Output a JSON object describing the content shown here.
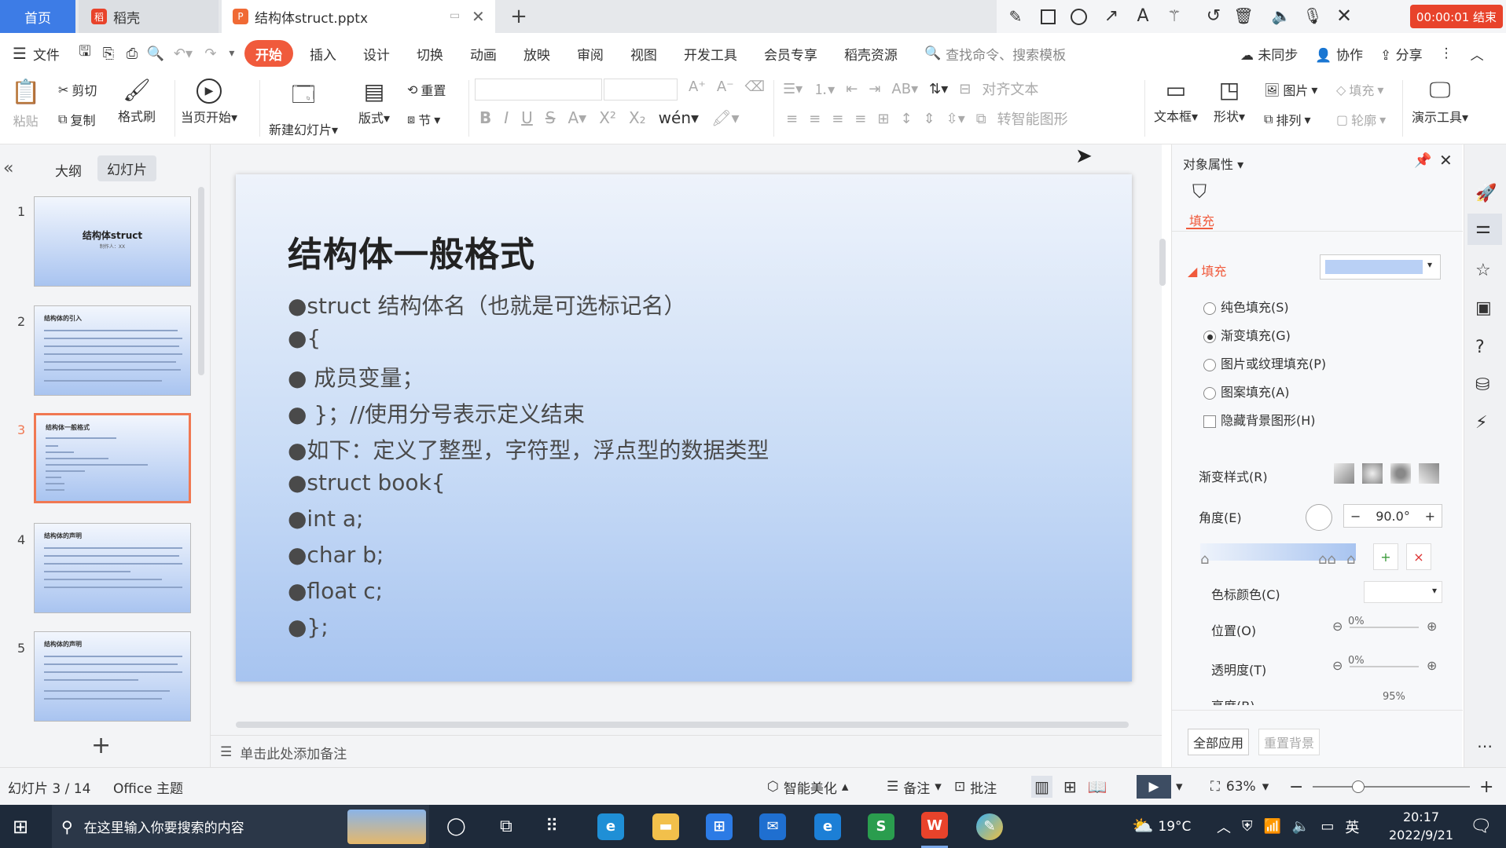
{
  "tabs": {
    "home": "首页",
    "daoke": "稻壳",
    "file": "结构体struct.pptx",
    "add": "+"
  },
  "recording": {
    "timer": "00:00:01 结束"
  },
  "menu": {
    "file": "文件",
    "items": [
      "开始",
      "插入",
      "设计",
      "切换",
      "动画",
      "放映",
      "审阅",
      "视图",
      "开发工具",
      "会员专享",
      "稻壳资源"
    ],
    "search_placeholder": "查找命令、搜索模板",
    "sync": "未同步",
    "collab": "协作",
    "share": "分享"
  },
  "toolbar": {
    "paste": "粘贴",
    "cut": "剪切",
    "copy": "复制",
    "format_painter": "格式刷",
    "from_current": "当页开始",
    "new_slide": "新建幻灯片",
    "layout": "版式",
    "reset": "重置",
    "section": "节",
    "align_text": "对齐文本",
    "convert_smartart": "转智能图形",
    "textbox": "文本框",
    "shape": "形状",
    "picture": "图片",
    "fill": "填充",
    "arrange": "排列",
    "outline": "轮廓",
    "presenter_tools": "演示工具"
  },
  "leftpanel": {
    "outline_tab": "大纲",
    "slides_tab": "幻灯片",
    "add": "+",
    "thumbs": [
      {
        "num": "1",
        "title": "结构体struct",
        "sub": "制作人：XX"
      },
      {
        "num": "2",
        "title": "结构体的引入"
      },
      {
        "num": "3",
        "title": "结构体一般格式"
      },
      {
        "num": "4",
        "title": "结构体的声明"
      },
      {
        "num": "5",
        "title": "结构体的声明"
      }
    ]
  },
  "slide": {
    "title": "结构体一般格式",
    "bullets": [
      "●struct 结构体名（也就是可选标记名）",
      "●{",
      "●  成员变量；",
      "●  }；//使用分号表示定义结束",
      "●如下：定义了整型，字符型，浮点型的数据类型",
      "●struct book{",
      "●int a;",
      "●char b;",
      "●float c;",
      "●};"
    ]
  },
  "notes": {
    "placeholder": "单击此处添加备注"
  },
  "rightpanel": {
    "title": "对象属性",
    "tab_fill": "填充",
    "section_fill": "填充",
    "options": [
      "纯色填充(S)",
      "渐变填充(G)",
      "图片或纹理填充(P)",
      "图案填充(A)"
    ],
    "selected_option": 1,
    "hide_bg": "隐藏背景图形(H)",
    "gradient_style": "渐变样式(R)",
    "angle_label": "角度(E)",
    "angle_value": "90.0°",
    "stop_color": "色标颜色(C)",
    "position_label": "位置(O)",
    "position_value": "0%",
    "transparency_label": "透明度(T)",
    "transparency_value": "0%",
    "brightness_label": "亮度(B)",
    "brightness_value": "95%",
    "apply_all": "全部应用",
    "reset_bg": "重置背景",
    "fill_color": "#b9d0f5"
  },
  "status": {
    "slide_info": "幻灯片 3 / 14",
    "theme": "Office 主题",
    "smart_beautify": "智能美化",
    "notes": "备注",
    "comments": "批注",
    "zoom": "63%"
  },
  "taskbar": {
    "search_placeholder": "在这里输入你要搜索的内容",
    "weather": "19°C",
    "ime": "英",
    "time": "20:17",
    "date": "2022/9/21"
  },
  "colors": {
    "accent": "#f05a3c",
    "tab_blue": "#3d7ce6",
    "taskbar": "#1e2a3a"
  }
}
